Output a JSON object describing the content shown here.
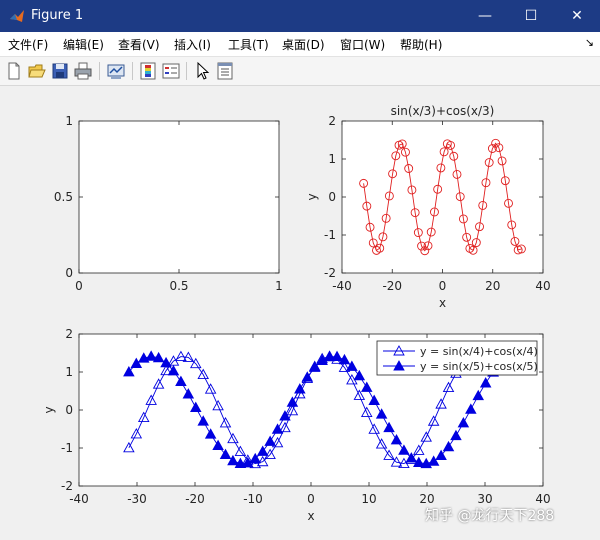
{
  "window": {
    "title": "Figure 1",
    "controls": {
      "minimize": "—",
      "maximize": "☐",
      "close": "✕"
    }
  },
  "menu": {
    "items": [
      "文件(F)",
      "编辑(E)",
      "查看(V)",
      "插入(I)",
      "工具(T)",
      "桌面(D)",
      "窗口(W)",
      "帮助(H)"
    ],
    "dock_glyph": "↘"
  },
  "toolbar": {
    "icons": [
      "new-figure-icon",
      "open-file-icon",
      "save-icon",
      "print-icon",
      "link-plot-icon",
      "insert-colorbar-icon",
      "insert-legend-icon",
      "edit-plot-cursor-icon",
      "property-inspector-icon"
    ]
  },
  "watermark": "知乎 @龙行天下288",
  "colors": {
    "titlebar": "#1d3b85",
    "red_series": "#e02020",
    "blue_series": "#0000e0"
  },
  "chart_data": [
    {
      "id": "empty-axes",
      "type": "line",
      "title": "",
      "xlabel": "",
      "ylabel": "",
      "xlim": [
        0,
        1
      ],
      "ylim": [
        0,
        1
      ],
      "xticks": [
        "0",
        "0.5",
        "1"
      ],
      "yticks": [
        "0",
        "0.5",
        "1"
      ],
      "series": []
    },
    {
      "id": "sin3-plot",
      "type": "line",
      "title": "sin(x/3)+cos(x/3)",
      "xlabel": "x",
      "ylabel": "y",
      "xlim": [
        -40,
        40
      ],
      "ylim": [
        -2,
        2
      ],
      "xticks": [
        "-40",
        "-20",
        "0",
        "20",
        "40"
      ],
      "yticks": [
        "-2",
        "-1",
        "0",
        "1",
        "2"
      ],
      "marker": "circle",
      "color": "#e02020",
      "x_range": [
        -31.4,
        31.4
      ],
      "points": 50,
      "expression": "sin(x/3)+cos(x/3)"
    },
    {
      "id": "sin4-sin5-plot",
      "type": "line",
      "title": "",
      "xlabel": "x",
      "ylabel": "y",
      "xlim": [
        -40,
        40
      ],
      "ylim": [
        -2,
        2
      ],
      "xticks": [
        "-40",
        "-30",
        "-20",
        "-10",
        "0",
        "10",
        "20",
        "30",
        "40"
      ],
      "yticks": [
        "-2",
        "-1",
        "0",
        "1",
        "2"
      ],
      "legend_position": "top-right",
      "x_range": [
        -31.4,
        31.4
      ],
      "points": 50,
      "series": [
        {
          "name": "y = sin(x/4)+cos(x/4)",
          "marker": "triangle-open",
          "color": "#0000e0",
          "expression": "sin(x/4)+cos(x/4)"
        },
        {
          "name": "y = sin(x/5)+cos(x/5)",
          "marker": "triangle-filled",
          "color": "#0000e0",
          "expression": "sin(x/5)+cos(x/5)"
        }
      ]
    }
  ]
}
